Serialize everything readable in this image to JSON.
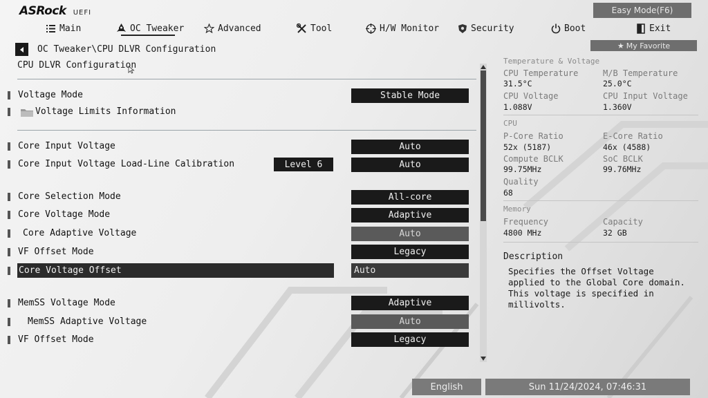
{
  "header": {
    "logo": "ASRock",
    "logo_sub": "UEFI",
    "easy_mode": "Easy Mode(F6)",
    "my_favorite": "My Favorite"
  },
  "nav": [
    {
      "label": "Main",
      "icon": "list-icon"
    },
    {
      "label": "OC Tweaker",
      "icon": "rocket-icon",
      "active": true
    },
    {
      "label": "Advanced",
      "icon": "star-icon"
    },
    {
      "label": "Tool",
      "icon": "tools-icon"
    },
    {
      "label": "H/W Monitor",
      "icon": "crosshair-icon"
    },
    {
      "label": "Security",
      "icon": "shield-icon"
    },
    {
      "label": "Boot",
      "icon": "power-icon"
    },
    {
      "label": "Exit",
      "icon": "exit-icon"
    }
  ],
  "breadcrumb": "OC Tweaker\\CPU DLVR Configuration",
  "page_title": "CPU DLVR Configuration",
  "settings": [
    {
      "label": "Voltage Mode",
      "value": "Stable Mode"
    },
    {
      "label": "Voltage Limits Information",
      "value": ""
    },
    {
      "label": "Core Input Voltage",
      "value": "Auto"
    },
    {
      "label": "Core Input Voltage Load-Line Calibration",
      "value": "Auto",
      "badge": "Level 6"
    },
    {
      "label": "Core Selection Mode",
      "value": "All-core"
    },
    {
      "label": "Core Voltage Mode",
      "value": "Adaptive"
    },
    {
      "label": "Core Adaptive Voltage",
      "value": "Auto"
    },
    {
      "label": "VF Offset Mode",
      "value": "Legacy"
    },
    {
      "label": "Core Voltage Offset",
      "value": "Auto"
    },
    {
      "label": "MemSS Voltage Mode",
      "value": "Adaptive"
    },
    {
      "label": "MemSS Adaptive Voltage",
      "value": "Auto"
    },
    {
      "label": "VF Offset Mode",
      "value": "Legacy"
    }
  ],
  "info": {
    "temp_section": "Temperature & Voltage",
    "cpu_temp_label": "CPU Temperature",
    "cpu_temp": "31.5°C",
    "mb_temp_label": "M/B Temperature",
    "mb_temp": "25.0°C",
    "cpu_volt_label": "CPU Voltage",
    "cpu_volt": "1.088V",
    "cpu_input_volt_label": "CPU Input Voltage",
    "cpu_input_volt": "1.360V",
    "cpu_section": "CPU",
    "pcore_label": "P-Core Ratio",
    "pcore": "52x (5187)",
    "ecore_label": "E-Core Ratio",
    "ecore": "46x (4588)",
    "compute_bclk_label": "Compute BCLK",
    "compute_bclk": "99.75MHz",
    "soc_bclk_label": "SoC BCLK",
    "soc_bclk": "99.76MHz",
    "quality_label": "Quality",
    "quality": "68",
    "mem_section": "Memory",
    "freq_label": "Frequency",
    "freq": "4800 MHz",
    "capacity_label": "Capacity",
    "capacity": "32 GB"
  },
  "description": {
    "title": "Description",
    "text": "Specifies the Offset Voltage applied to the Global Core domain. This voltage is specified in millivolts."
  },
  "footer": {
    "language": "English",
    "datetime": "Sun 11/24/2024, 07:46:31"
  }
}
